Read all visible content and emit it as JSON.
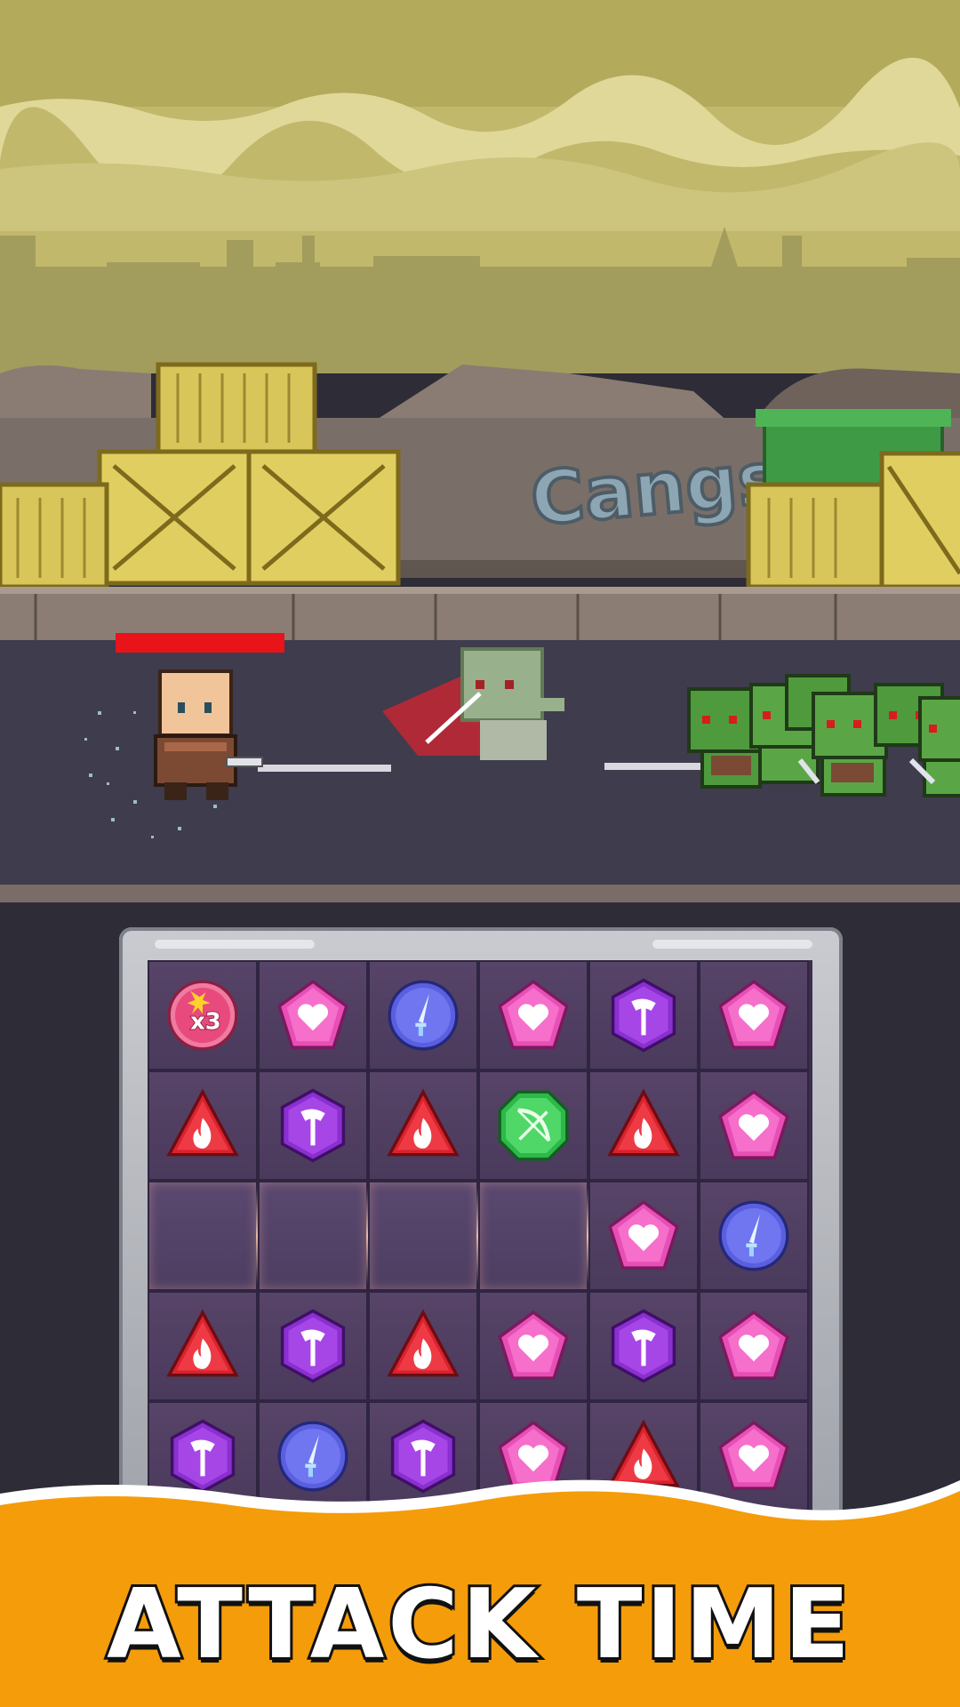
{
  "banner": {
    "title": "ATTACK TIME"
  },
  "scene": {
    "wall_graffiti": "Cangsil"
  },
  "player": {
    "health_fraction": 1.0
  },
  "enemies": {
    "goblin_count": 6
  },
  "board": {
    "columns": 6,
    "visible_rows": 5,
    "rows": [
      [
        "multiplier-x3",
        "heart",
        "sword",
        "heart",
        "axe",
        "heart"
      ],
      [
        "fire",
        "axe",
        "fire",
        "bow",
        "fire",
        "heart"
      ],
      [
        "empty",
        "empty",
        "empty",
        "empty",
        "heart",
        "sword"
      ],
      [
        "fire",
        "axe",
        "fire",
        "heart",
        "axe",
        "heart"
      ],
      [
        "axe",
        "sword",
        "axe",
        "heart",
        "fire",
        "heart"
      ]
    ],
    "multiplier_label": "x3"
  },
  "colors": {
    "sky": "#c9c07a",
    "road": "#3d3b4c",
    "banner": "#f59c0a",
    "heart_gem": "#e84fb6",
    "sword_gem": "#5a5fe0",
    "axe_gem": "#8a2fd0",
    "fire_gem": "#d9222e",
    "bow_gem": "#2fb84a"
  }
}
